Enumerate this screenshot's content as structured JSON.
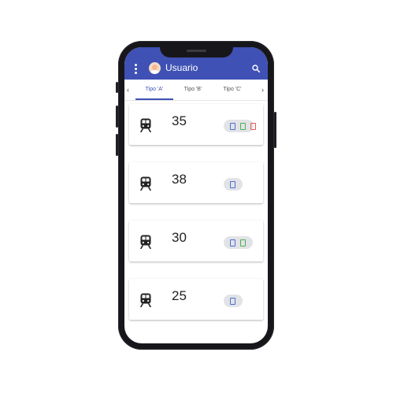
{
  "app": {
    "title": "Usuario"
  },
  "tabs": [
    {
      "label": "Tipo 'A'",
      "active": true
    },
    {
      "label": "Tipo 'B'",
      "active": false
    },
    {
      "label": "Tipo 'C'",
      "active": false
    }
  ],
  "cards": [
    {
      "number": "35",
      "docs": [
        "blue",
        "green",
        "red"
      ]
    },
    {
      "number": "38",
      "docs": [
        "blue"
      ]
    },
    {
      "number": "30",
      "docs": [
        "blue",
        "green"
      ]
    },
    {
      "number": "25",
      "docs": [
        "blue"
      ]
    }
  ],
  "colors": {
    "primary": "#3f51b5",
    "doc_blue": "#4a6fd0",
    "doc_green": "#4caf50",
    "doc_red": "#e35b4f"
  },
  "icons": {
    "menu": "more-vert-icon",
    "search": "search-icon",
    "avatar": "user-avatar",
    "card": "train-icon",
    "doc": "document-icon"
  }
}
